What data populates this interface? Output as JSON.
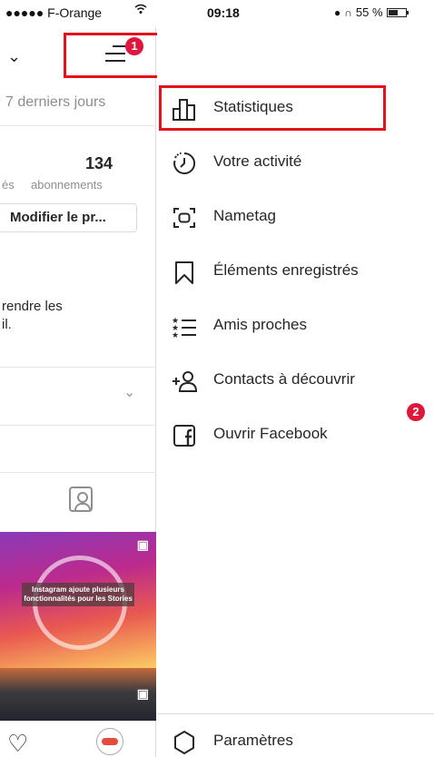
{
  "status_bar": {
    "carrier": "●●●●● F-Orange",
    "time": "09:18",
    "battery": "55 %",
    "battery_level": 0.55
  },
  "profile": {
    "period": "7 derniers jours",
    "following_count": "134",
    "left_stat_label_partial": "és",
    "following_label": "abonnements",
    "edit_button": "Modifier le pr...",
    "bio_line1": "rendre les",
    "bio_line2": "il.",
    "menu_badge": "1",
    "story_caption": "Instagram ajoute plusieurs fonctionnalités pour les Stories"
  },
  "menu": {
    "items": [
      {
        "label": "Statistiques",
        "icon": "bar-chart-icon"
      },
      {
        "label": "Votre activité",
        "icon": "activity-clock-icon"
      },
      {
        "label": "Nametag",
        "icon": "nametag-icon"
      },
      {
        "label": "Éléments enregistrés",
        "icon": "bookmark-icon"
      },
      {
        "label": "Amis proches",
        "icon": "close-friends-list-icon"
      },
      {
        "label": "Contacts à découvrir",
        "icon": "add-person-icon"
      },
      {
        "label": "Ouvrir Facebook",
        "icon": "facebook-icon"
      }
    ],
    "contacts_badge": "2",
    "settings_label": "Paramètres"
  },
  "colors": {
    "highlight_red": "#e3121b",
    "badge_red": "#e0173c",
    "text": "#262626",
    "muted": "#8e8e8e"
  }
}
